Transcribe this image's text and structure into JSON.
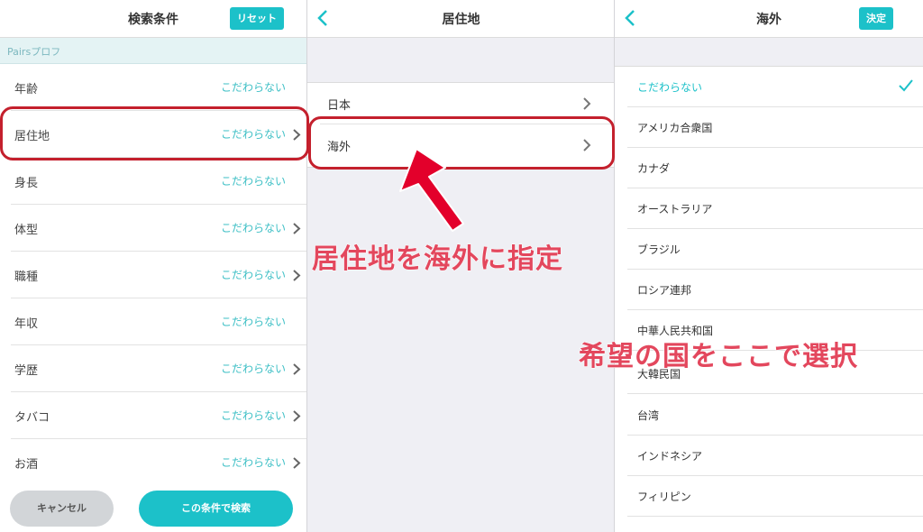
{
  "panel1": {
    "title": "検索条件",
    "reset_label": "リセット",
    "section": "Pairsプロフ",
    "rows": [
      {
        "label": "年齢",
        "value": "こだわらない",
        "chevron": false
      },
      {
        "label": "居住地",
        "value": "こだわらない",
        "chevron": true
      },
      {
        "label": "身長",
        "value": "こだわらない",
        "chevron": false
      },
      {
        "label": "体型",
        "value": "こだわらない",
        "chevron": true
      },
      {
        "label": "職種",
        "value": "こだわらない",
        "chevron": true
      },
      {
        "label": "年収",
        "value": "こだわらない",
        "chevron": false
      },
      {
        "label": "学歴",
        "value": "こだわらない",
        "chevron": true
      },
      {
        "label": "タバコ",
        "value": "こだわらない",
        "chevron": true
      },
      {
        "label": "お酒",
        "value": "こだわらない",
        "chevron": true
      }
    ],
    "cancel_label": "キャンセル",
    "search_label": "この条件で検索"
  },
  "panel2": {
    "title": "居住地",
    "rows": [
      {
        "label": "日本"
      },
      {
        "label": "海外"
      }
    ]
  },
  "panel3": {
    "title": "海外",
    "confirm_label": "決定",
    "items": [
      {
        "label": "こだわらない",
        "selected": true
      },
      {
        "label": "アメリカ合衆国"
      },
      {
        "label": "カナダ"
      },
      {
        "label": "オーストラリア"
      },
      {
        "label": "ブラジル"
      },
      {
        "label": "ロシア連邦"
      },
      {
        "label": "中華人民共和国"
      },
      {
        "label": "大韓民国"
      },
      {
        "label": "台湾"
      },
      {
        "label": "インドネシア"
      },
      {
        "label": "フィリピン"
      }
    ]
  },
  "annotations": {
    "text1": "居住地を海外に指定",
    "text2": "希望の国をここで選択"
  },
  "colors": {
    "accent": "#1cc1c9",
    "value_text": "#3dbfc5",
    "highlight": "#c4202d",
    "annotation": "#e3475d"
  },
  "icons": {
    "back": "chevron-left-icon",
    "row_chevron": "chevron-right-icon",
    "selected": "checkmark-icon",
    "pointer": "red-arrow-icon"
  }
}
